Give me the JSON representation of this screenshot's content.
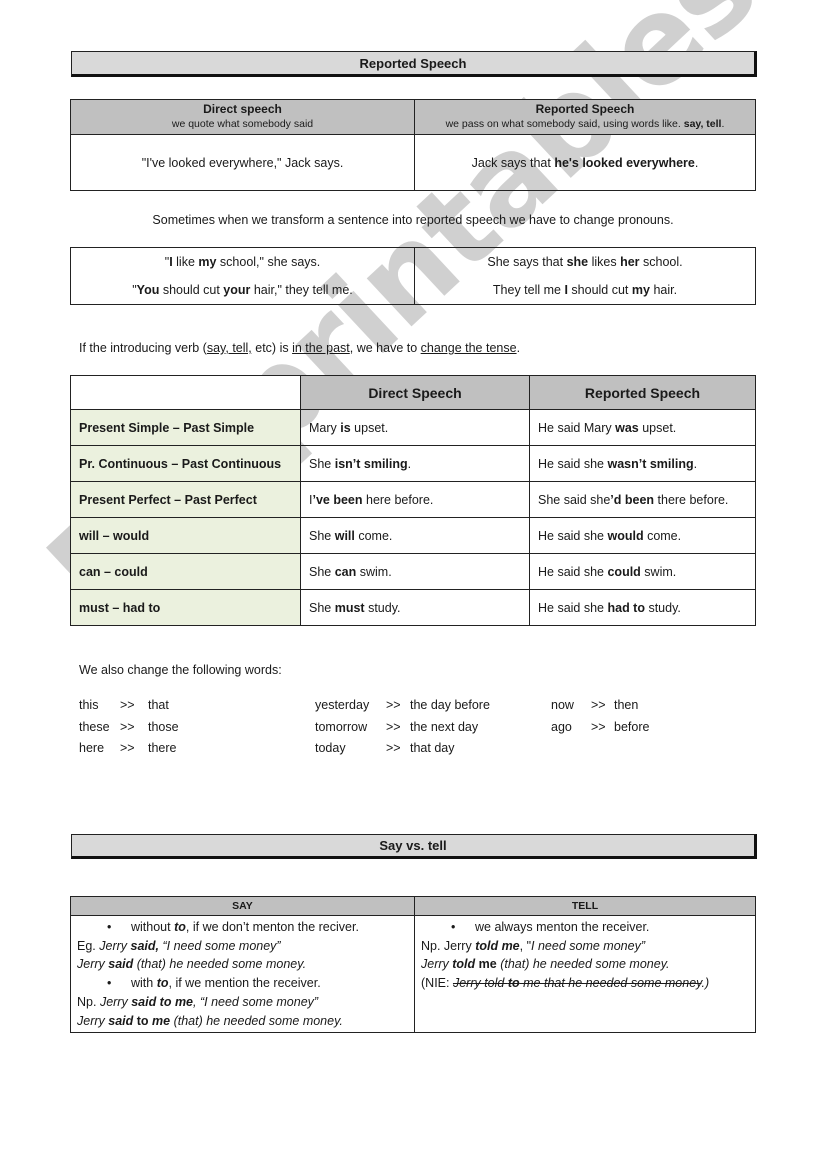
{
  "title": "Reported Speech",
  "intro_table": {
    "direct_header": "Direct speech",
    "direct_sub": "we quote what somebody said",
    "reported_header": "Reported Speech",
    "reported_sub": "we pass on what somebody said, using words like.",
    "reported_sub_bold": "say, tell",
    "reported_sub_end": ".",
    "direct_example": "\"I've looked everywhere,\" Jack says.",
    "reported_example_pre": "Jack says that ",
    "reported_example_bold": "he's looked everywhere",
    "reported_example_end": "."
  },
  "pronouns_note": "Sometimes when we transform a sentence into reported speech we have to change pronouns.",
  "pronouns_table": {
    "d1": [
      "\"",
      "I",
      " like ",
      "my",
      " school,\" she says."
    ],
    "d2": [
      "\"",
      "You",
      " should cut ",
      "your",
      " hair,\" they tell me."
    ],
    "r1": [
      "She says that ",
      "she",
      " likes ",
      "her",
      " school."
    ],
    "r2": [
      "They tell me ",
      "I",
      " should cut ",
      "my",
      " hair."
    ]
  },
  "tense_note": {
    "p1": "If the introducing verb (",
    "u1": "say, tell,",
    "p2": " etc) is ",
    "u2": "in the past",
    "p3": ", we have to ",
    "u3": "change the tense",
    "p4": "."
  },
  "tense_table": {
    "headers": [
      "",
      "Direct Speech",
      "Reported Speech"
    ],
    "rows": [
      {
        "label": "Present Simple – Past Simple",
        "d": [
          "Mary ",
          "is",
          " upset."
        ],
        "r": [
          "He said Mary ",
          "was",
          " upset."
        ]
      },
      {
        "label": "Pr. Continuous – Past Continuous",
        "d": [
          "She ",
          "isn’t smiling",
          "."
        ],
        "r": [
          "He said she ",
          "wasn’t smiling",
          "."
        ]
      },
      {
        "label": "Present Perfect – Past Perfect",
        "d": [
          "I",
          "’ve been",
          " here before."
        ],
        "r": [
          "She said she",
          "’d been",
          " there before."
        ]
      },
      {
        "label": "will – would",
        "d": [
          "She ",
          "will",
          " come."
        ],
        "r": [
          "He said she ",
          "would",
          " come."
        ]
      },
      {
        "label": "can – could",
        "d": [
          "She ",
          "can",
          " swim."
        ],
        "r": [
          "He said she ",
          "could",
          " swim."
        ]
      },
      {
        "label": "must – had to",
        "d": [
          "She ",
          "must",
          " study."
        ],
        "r": [
          "He said she ",
          "had to",
          " study."
        ]
      }
    ]
  },
  "words_note": "We also change the following words:",
  "word_changes": {
    "arrow": ">>",
    "col1": [
      [
        "this",
        "that"
      ],
      [
        "these",
        "those"
      ],
      [
        "here",
        "there"
      ]
    ],
    "col2": [
      [
        "yesterday",
        "the day before"
      ],
      [
        "tomorrow",
        "the next day"
      ],
      [
        "today",
        "that day"
      ]
    ],
    "col3": [
      [
        "now",
        "then"
      ],
      [
        "ago",
        "before"
      ]
    ]
  },
  "say_tell_title": "Say vs. tell",
  "say_tell": {
    "say_header": "SAY",
    "tell_header": "TELL",
    "bullet": "•",
    "say": {
      "b1": [
        "without ",
        "to",
        ", if we don’t menton the reciver."
      ],
      "e1": [
        "Eg. ",
        "Jerry ",
        "said,",
        " “I need some money”"
      ],
      "e2": [
        "Jerry ",
        "said",
        " (that) he needed some money."
      ],
      "b2": [
        "with ",
        "to",
        ", if we mention the receiver."
      ],
      "e3": [
        "Np. ",
        "Jerry ",
        "said to me",
        ", “I need some money”"
      ],
      "e4": [
        "Jerry ",
        "said",
        " to ",
        "me",
        " (that) he needed some money."
      ]
    },
    "tell": {
      "b1": "we always menton the receiver.",
      "e1": [
        "Np. Jerry ",
        "told me",
        ", \"",
        "I need some money”"
      ],
      "e2": [
        "Jerry ",
        "told",
        " me ",
        "(that) he needed some money."
      ],
      "e3": [
        "(NIE: ",
        "Jerry told ",
        "to",
        " me that he needed some money",
        ".)"
      ]
    }
  },
  "watermark": "ESLprintables.com"
}
